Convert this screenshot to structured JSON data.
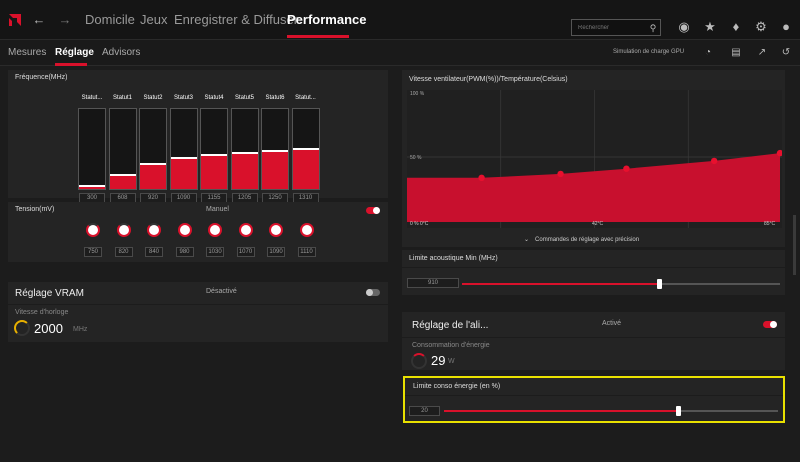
{
  "nav": {
    "tabs": [
      "Domicile",
      "Jeux",
      "Enregistrer & Diffuser",
      "Performance"
    ],
    "active": "Performance",
    "search_placeholder": "Rechercher"
  },
  "subnav": {
    "tabs": [
      "Mesures",
      "Réglage",
      "Advisors"
    ],
    "active": "Réglage",
    "sim_label": "Simulation de charge GPU"
  },
  "frequency": {
    "title": "Fréquence(MHz)",
    "states": [
      {
        "label": "Statut...",
        "value": "300",
        "fill": 0.04
      },
      {
        "label": "Statut1",
        "value": "608",
        "fill": 0.17
      },
      {
        "label": "Statut2",
        "value": "920",
        "fill": 0.31
      },
      {
        "label": "Statut3",
        "value": "1090",
        "fill": 0.39
      },
      {
        "label": "Statut4",
        "value": "1155",
        "fill": 0.42
      },
      {
        "label": "Statut5",
        "value": "1205",
        "fill": 0.45
      },
      {
        "label": "Statut6",
        "value": "1250",
        "fill": 0.47
      },
      {
        "label": "Statut...",
        "value": "1310",
        "fill": 0.5
      }
    ]
  },
  "voltage": {
    "title": "Tension(mV)",
    "mode_label": "Manuel",
    "values": [
      "750",
      "820",
      "840",
      "980",
      "1030",
      "1070",
      "1090",
      "1110"
    ]
  },
  "vram": {
    "title": "Réglage VRAM",
    "status": "Désactivé",
    "clock_label": "Vitesse d'horloge",
    "clock_value": "2000",
    "clock_unit": "MHz"
  },
  "fan": {
    "title": "Vitesse ventilateur(PWM(%))/Température(Celsius)",
    "y_top": "100 %",
    "y_mid": "50 %",
    "x_start": "0 % 0°C",
    "x_mid": "42°C",
    "x_end": "85°C",
    "precision_label": "Commandes de réglage avec précision",
    "chart_data": {
      "type": "area",
      "x": [
        0,
        17,
        35,
        50,
        70,
        85
      ],
      "y": [
        34,
        34,
        37,
        41,
        47,
        53
      ],
      "xlim": [
        0,
        85
      ],
      "ylim": [
        0,
        100
      ]
    }
  },
  "acoustic": {
    "title": "Limite acoustique Min (MHz)",
    "value": "910",
    "fill": 0.62
  },
  "power_tuning": {
    "title": "Réglage de l'ali...",
    "status": "Activé",
    "consumption_label": "Consommation d'énergie",
    "consumption_value": "29",
    "consumption_unit": "W"
  },
  "power_limit": {
    "title": "Limite conso énergie (en %)",
    "value": "20",
    "fill": 0.7,
    "highlight_color": "#e8e000"
  }
}
